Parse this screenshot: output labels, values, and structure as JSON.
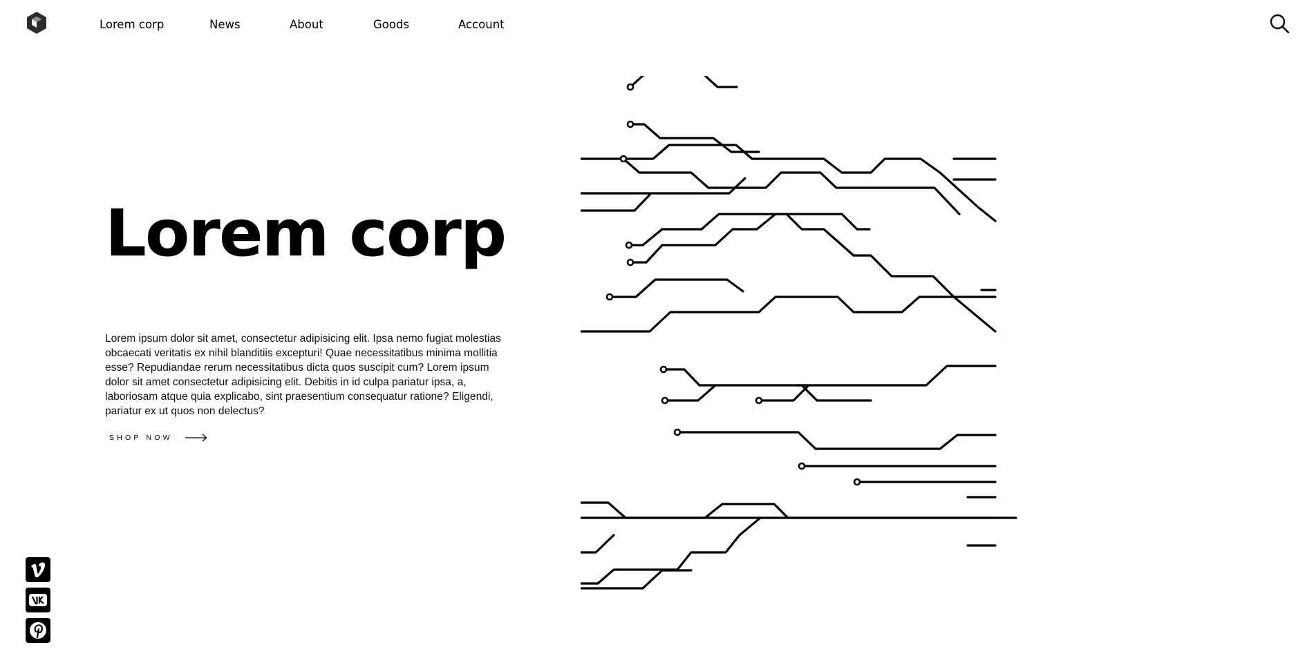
{
  "brand": {
    "logo_icon": "cube-logo-icon"
  },
  "nav": {
    "items": [
      {
        "label": "Lorem corp"
      },
      {
        "label": "News"
      },
      {
        "label": "About"
      },
      {
        "label": "Goods"
      },
      {
        "label": "Account"
      }
    ],
    "search_icon": "search-icon"
  },
  "hero": {
    "title": "Lorem corp",
    "description": "Lorem ipsum dolor sit amet, consectetur adipisicing elit. Ipsa nemo fugiat molestias obcaecati veritatis ex nihil blanditiis excepturi! Quae necessitatibus minima mollitia esse? Repudiandae rerum necessitatibus dicta quos suscipit cum? Lorem ipsum dolor sit amet consectetur adipisicing elit. Debitis in id culpa pariatur ipsa, a, laboriosam atque quia explicabo, sint praesentium consequatur ratione? Eligendi, pariatur ex ut quos non delectus?",
    "cta_label": "SHOP NOW",
    "cta_icon": "arrow-right-icon"
  },
  "social": [
    {
      "icon": "vimeo-icon"
    },
    {
      "icon": "vk-icon"
    },
    {
      "icon": "pinterest-icon"
    }
  ],
  "illustration": {
    "icon": "circuit-board-illustration"
  },
  "colors": {
    "text": "#000000",
    "background": "#ffffff"
  }
}
